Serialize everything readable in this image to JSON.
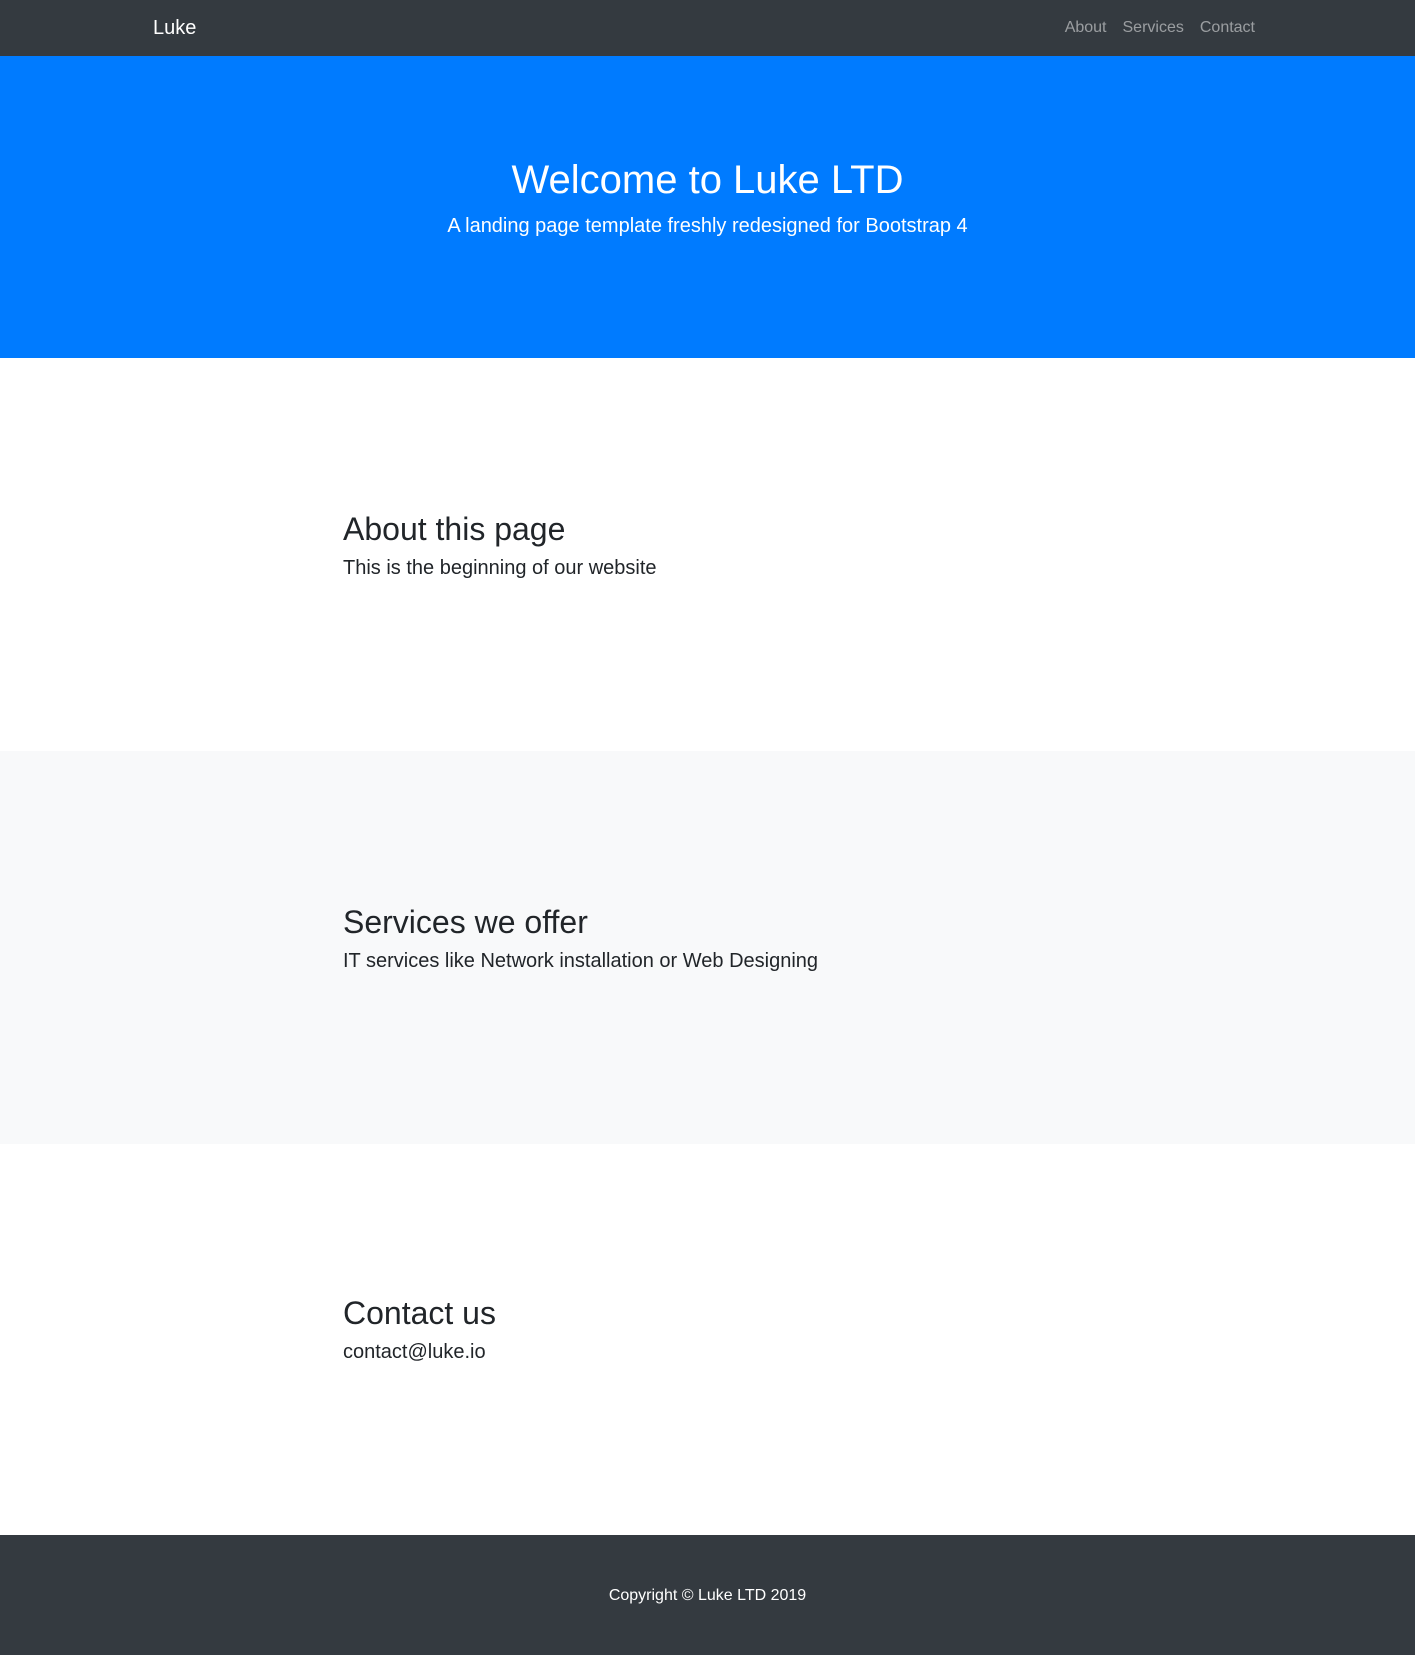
{
  "navbar": {
    "brand": "Luke",
    "links": [
      {
        "label": "About"
      },
      {
        "label": "Services"
      },
      {
        "label": "Contact"
      }
    ]
  },
  "hero": {
    "title": "Welcome to Luke LTD",
    "subtitle": "A landing page template freshly redesigned for Bootstrap 4"
  },
  "sections": {
    "about": {
      "title": "About this page",
      "text": "This is the beginning of our website"
    },
    "services": {
      "title": "Services we offer",
      "text": "IT services like Network installation or Web Designing"
    },
    "contact": {
      "title": "Contact us",
      "text": "contact@luke.io"
    }
  },
  "footer": {
    "copyright": "Copyright © Luke LTD 2019"
  },
  "colors": {
    "navbar_bg": "#343a40",
    "hero_bg": "#007bff",
    "light_section_bg": "#f8f9fa",
    "text": "#212529"
  }
}
